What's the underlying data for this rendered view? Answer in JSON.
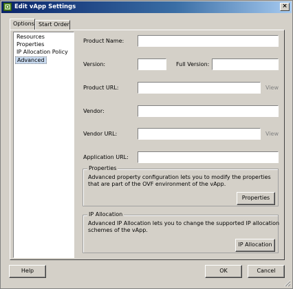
{
  "window": {
    "title": "Edit vApp Settings",
    "close_glyph": "×"
  },
  "tabs": [
    {
      "label": "Options"
    },
    {
      "label": "Start Order"
    }
  ],
  "nav": {
    "items": [
      {
        "label": "Resources"
      },
      {
        "label": "Properties"
      },
      {
        "label": "IP Allocation Policy"
      },
      {
        "label": "Advanced"
      }
    ],
    "selected": "Advanced"
  },
  "form": {
    "product_name": {
      "label": "Product Name:",
      "value": ""
    },
    "version": {
      "label": "Version:",
      "value": ""
    },
    "full_version": {
      "label": "Full Version:",
      "value": ""
    },
    "product_url": {
      "label": "Product URL:",
      "value": "",
      "view_label": "View"
    },
    "vendor": {
      "label": "Vendor:",
      "value": ""
    },
    "vendor_url": {
      "label": "Vendor URL:",
      "value": "",
      "view_label": "View"
    },
    "application_url": {
      "label": "Application URL:",
      "value": ""
    }
  },
  "properties_group": {
    "title": "Properties",
    "description": "Advanced property configuration lets you to modify the properties that are part of the OVF environment of the vApp.",
    "button_label": "Properties"
  },
  "ip_group": {
    "title": "IP Allocation",
    "description": "Advanced IP Allocation lets you to change the supported IP allocation schemes of the vApp.",
    "button_label": "IP Allocation"
  },
  "footer": {
    "help_label": "Help",
    "ok_label": "OK",
    "cancel_label": "Cancel"
  },
  "colors": {
    "titlebar": "#0a246a",
    "dialog_bg": "#d4d0c8",
    "selection": "#c8daf0",
    "app_icon": "#4e8a1f"
  }
}
